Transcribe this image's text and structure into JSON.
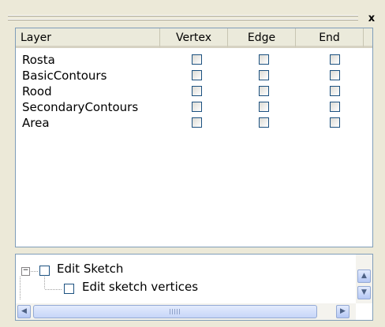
{
  "window": {
    "close_glyph": "x"
  },
  "snapping": {
    "columns": {
      "layer": "Layer",
      "vertex": "Vertex",
      "edge": "Edge",
      "end": "End"
    },
    "layers": [
      {
        "name": "Rosta",
        "vertex": false,
        "edge": false,
        "end": false
      },
      {
        "name": "BasicContours",
        "vertex": false,
        "edge": false,
        "end": false
      },
      {
        "name": "Rood",
        "vertex": false,
        "edge": false,
        "end": false
      },
      {
        "name": "SecondaryContours",
        "vertex": false,
        "edge": false,
        "end": false
      },
      {
        "name": "Area",
        "vertex": false,
        "edge": false,
        "end": false
      }
    ]
  },
  "tree": {
    "expander_glyph": "−",
    "root": {
      "label": "Edit Sketch",
      "checked": false
    },
    "child": {
      "label": "Edit sketch vertices",
      "checked": false
    }
  },
  "scrollbars": {
    "up_icon": "chevron-up-icon",
    "down_icon": "chevron-down-icon",
    "left_icon": "chevron-left-icon",
    "right_icon": "chevron-right-icon"
  }
}
